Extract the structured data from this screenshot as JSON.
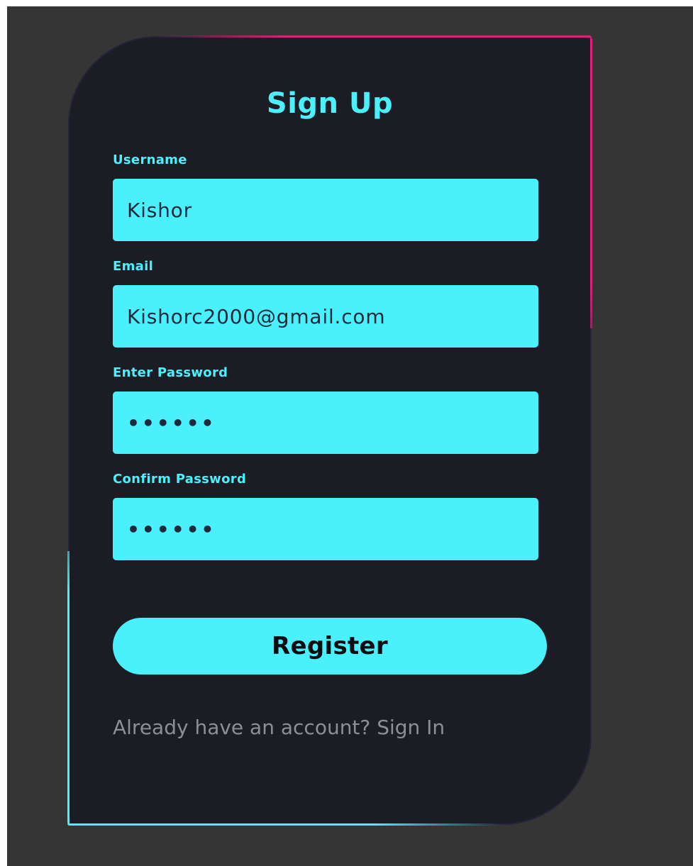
{
  "form": {
    "title": "Sign Up",
    "fields": [
      {
        "label": "Username",
        "value": "Kishor"
      },
      {
        "label": "Email",
        "value": "Kishorc2000@gmail.com"
      },
      {
        "label": "Enter Password",
        "value": "••••••"
      },
      {
        "label": "Confirm Password",
        "value": "••••••"
      }
    ],
    "submit_label": "Register",
    "footer_prompt": "Already have an account?",
    "footer_link": "Sign In"
  },
  "colors": {
    "accent": "#4af1fc",
    "secondary_accent": "#e0207c",
    "card_background": "#1c1c24",
    "page_background": "#353535",
    "muted_text": "#8e8e96"
  }
}
